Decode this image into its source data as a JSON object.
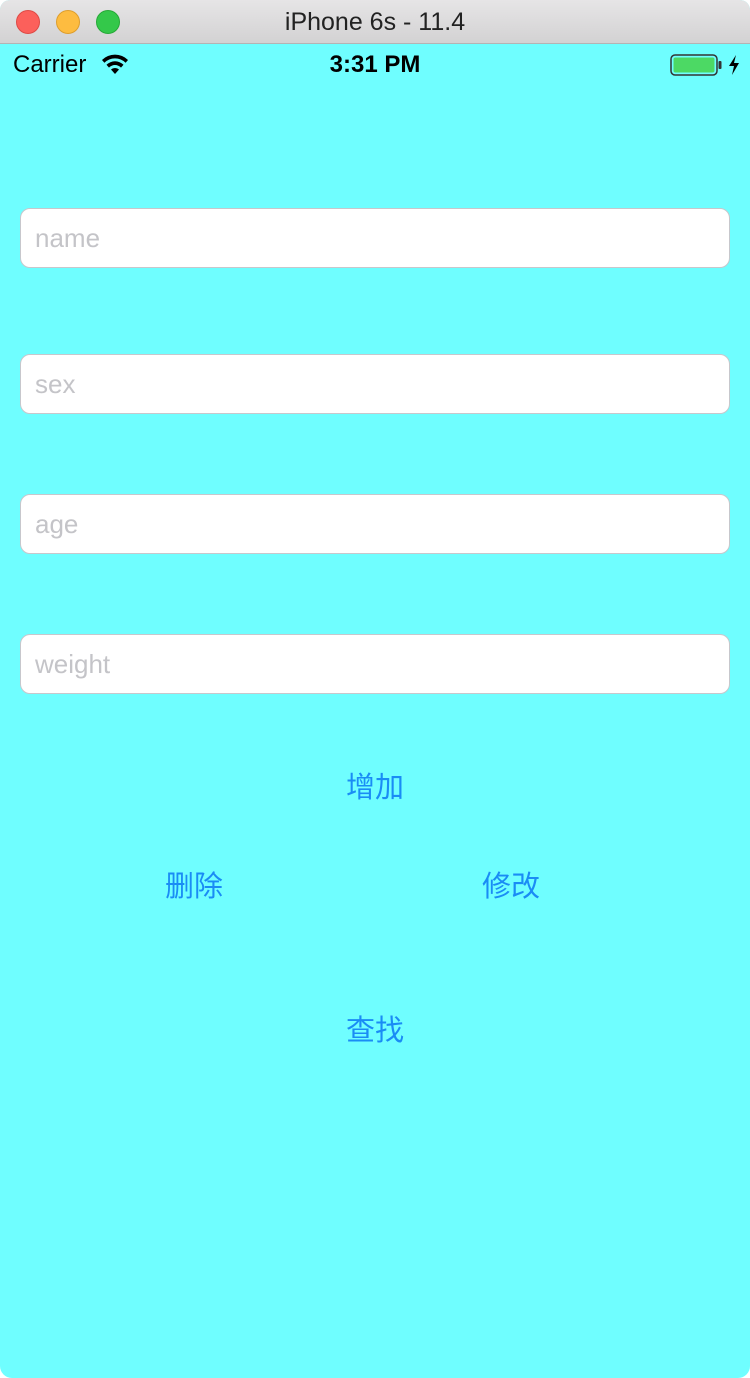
{
  "window": {
    "title": "iPhone 6s - 11.4"
  },
  "status_bar": {
    "carrier": "Carrier",
    "time": "3:31 PM",
    "icons": [
      "wifi-icon",
      "battery-icon",
      "charging-icon"
    ]
  },
  "form": {
    "name_placeholder": "name",
    "sex_placeholder": "sex",
    "age_placeholder": "age",
    "weight_placeholder": "weight"
  },
  "buttons": {
    "add": "增加",
    "delete": "删除",
    "modify": "修改",
    "search": "查找"
  },
  "colors": {
    "background": "#6ffeff",
    "button_text": "#1a8cf5",
    "battery_fill": "#4cd964"
  }
}
